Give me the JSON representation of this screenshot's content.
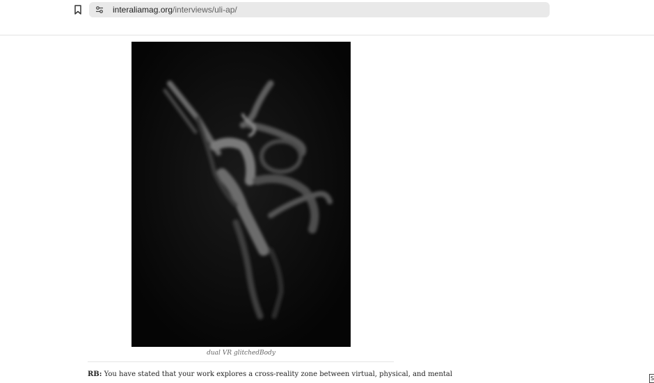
{
  "browser": {
    "url_domain": "interaliamag.org",
    "url_path": "/interviews/uli-ap/",
    "bookmark_icon": "bookmark-icon",
    "site_info_icon": "tune-icon"
  },
  "article": {
    "image_caption": "dual VR glitchedBody",
    "speaker": "RB:",
    "paragraph": "You have stated that your work explores a cross-reality zone between virtual, physical, and mental"
  },
  "corner_widget": {
    "label": "S"
  },
  "colors": {
    "omnibox_bg": "#e9e9e9",
    "artwork_bg": "#060606",
    "caption": "#666666",
    "body_text": "#222222"
  }
}
